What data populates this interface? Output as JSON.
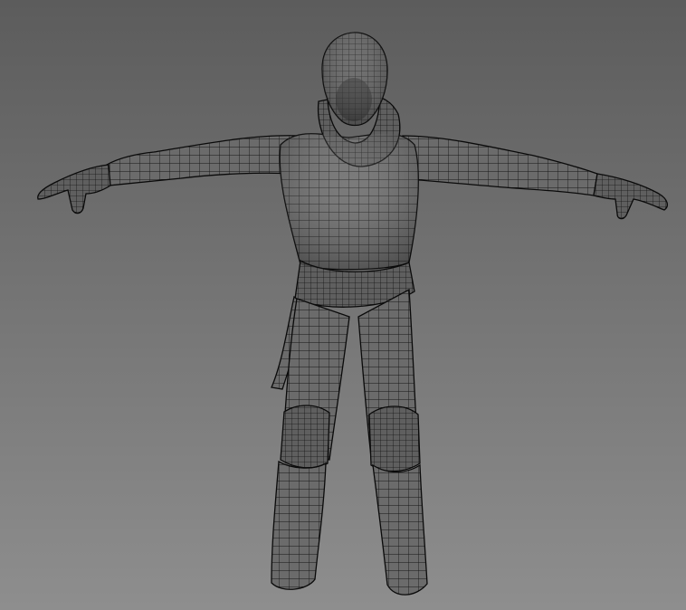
{
  "viewport": {
    "background_top": "#5c5c5c",
    "background_bottom": "#8e8e8e"
  },
  "model": {
    "shading": "wireframe-on-shaded",
    "pose": "t-pose",
    "surface_color": "#6b6b6b",
    "wire_color": "#0a0a0a"
  }
}
